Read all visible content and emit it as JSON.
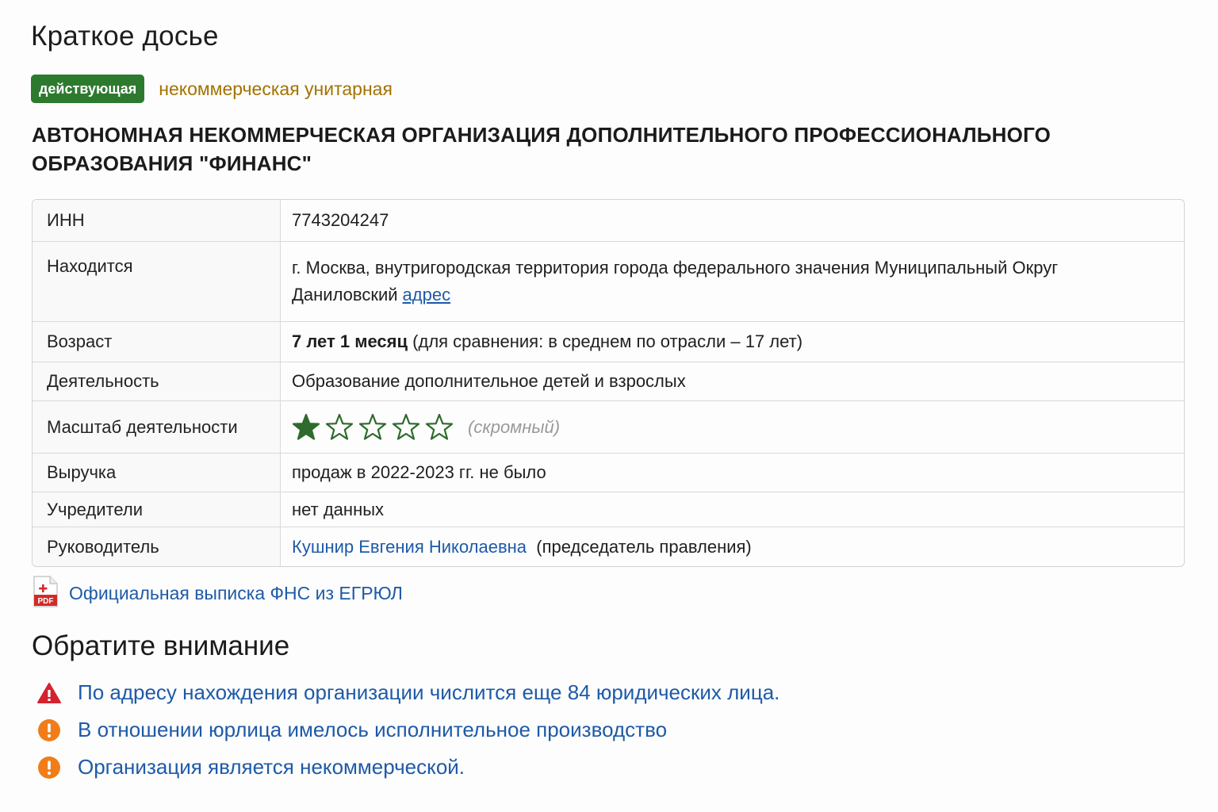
{
  "title": "Краткое досье",
  "status": {
    "badge": "действующая",
    "org_type": "некоммерческая унитарная"
  },
  "org_name": "АВТОНОМНАЯ НЕКОММЕРЧЕСКАЯ ОРГАНИЗАЦИЯ ДОПОЛНИТЕЛЬНОГО ПРОФЕССИОНАЛЬНОГО ОБРАЗОВАНИЯ \"ФИНАНС\"",
  "colors": {
    "badge_bg": "#2d7a2f",
    "org_type": "#a37200",
    "link": "#1e5aa8",
    "star": "#2e6b2d",
    "warn_red": "#d3232f",
    "warn_orange": "#f07d1a"
  },
  "table": {
    "inn": {
      "label": "ИНН",
      "value": "7743204247"
    },
    "location": {
      "label": "Находится",
      "value": "г. Москва, внутригородская территория города федерального значения Муниципальный Округ Даниловский",
      "link": "адрес"
    },
    "age": {
      "label": "Возраст",
      "value_bold": "7 лет 1 месяц",
      "value_rest": "(для сравнения: в среднем по отрасли – 17 лет)"
    },
    "activity": {
      "label": "Деятельность",
      "value": "Образование дополнительное детей и взрослых"
    },
    "scale": {
      "label": "Масштаб деятельности",
      "stars_filled": 1,
      "stars_total": 5,
      "note": "(скромный)"
    },
    "revenue": {
      "label": "Выручка",
      "value": "продаж в 2022-2023 гг. не было"
    },
    "founders": {
      "label": "Учредители",
      "value": "нет данных"
    },
    "head": {
      "label": "Руководитель",
      "name": "Кушнир Евгения Николаевна",
      "role": "(председатель правления)"
    }
  },
  "pdf": {
    "icon": "pdf-file-icon",
    "icon_label": "PDF",
    "link": "Официальная выписка ФНС из ЕГРЮЛ"
  },
  "attention": {
    "title": "Обратите внимание",
    "items": [
      {
        "icon": "warning-triangle-icon",
        "text": "По адресу нахождения организации числится еще 84 юридических лица."
      },
      {
        "icon": "exclamation-circle-icon",
        "text": "В отношении юрлица имелось исполнительное производство"
      },
      {
        "icon": "exclamation-circle-icon",
        "text": "Организация является некоммерческой."
      }
    ]
  }
}
